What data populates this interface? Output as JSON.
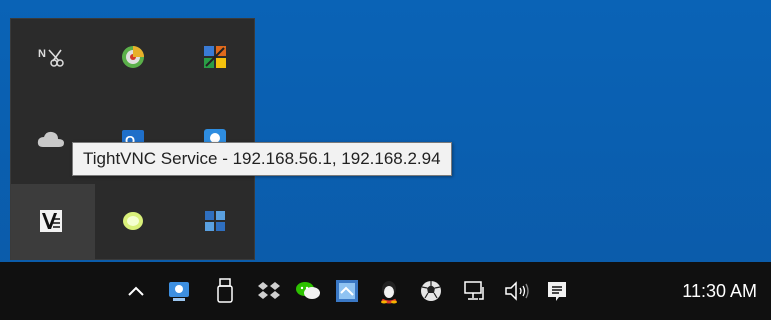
{
  "tooltip": {
    "text": "TightVNC Service - 192.168.56.1, 192.168.2.94"
  },
  "clock": {
    "time": "11:30 AM"
  },
  "flyout_icons": [
    {
      "name": "network-scissors-icon"
    },
    {
      "name": "disc-burner-icon"
    },
    {
      "name": "tool-color-icon"
    },
    {
      "name": "onedrive-cloud-icon"
    },
    {
      "name": "outlook-icon"
    },
    {
      "name": "remote-app-icon"
    },
    {
      "name": "tightvnc-icon"
    },
    {
      "name": "lime-ball-icon"
    },
    {
      "name": "puzzle-app-icon"
    }
  ],
  "taskbar_icons": [
    "show-hidden-icons-chevron",
    "remote-desktop-icon",
    "usb-drive-icon",
    "dropbox-like-icon",
    "wechat-icon",
    "screenshot-tool-icon",
    "qq-penguin-icon",
    "soccer-ball-icon",
    "network-icon",
    "volume-icon",
    "action-center-icon"
  ],
  "colors": {
    "desktop": "#0a63b6",
    "taskbar": "#101010",
    "flyout": "#2b2b2b",
    "tooltip_bg": "#f2f2f2"
  }
}
